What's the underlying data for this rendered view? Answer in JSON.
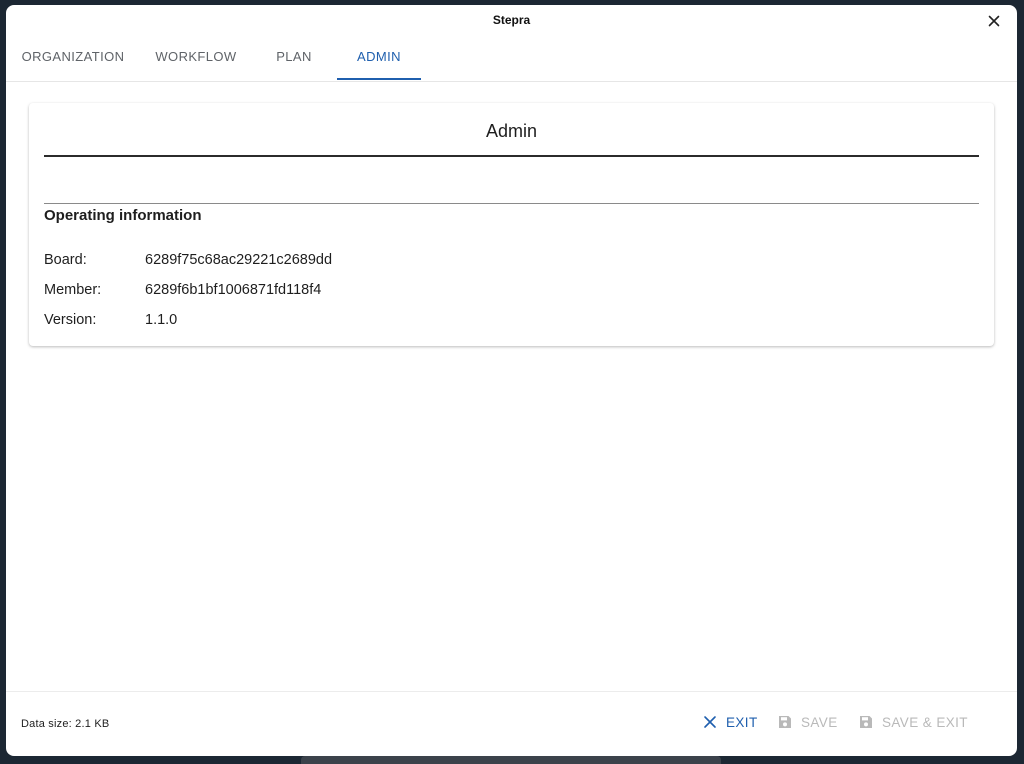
{
  "window": {
    "title": "Stepra"
  },
  "tabs": [
    {
      "label": "ORGANIZATION",
      "active": false
    },
    {
      "label": "WORKFLOW",
      "active": false
    },
    {
      "label": "PLAN",
      "active": false
    },
    {
      "label": "ADMIN",
      "active": true
    }
  ],
  "card": {
    "title": "Admin",
    "section_heading": "Operating information",
    "rows": [
      {
        "label": "Board:",
        "value": "6289f75c68ac29221c2689dd"
      },
      {
        "label": "Member:",
        "value": "6289f6b1bf1006871fd118f4"
      },
      {
        "label": "Version:",
        "value": "1.1.0"
      }
    ]
  },
  "footer": {
    "data_size": "Data size: 2.1 KB",
    "exit_label": "EXIT",
    "save_label": "SAVE",
    "save_exit_label": "SAVE & EXIT"
  },
  "colors": {
    "accent": "#1f5fae",
    "disabled": "#b9b9b9",
    "backdrop": "#1c2733"
  },
  "icons": {
    "close": "close-icon",
    "exit": "close-icon",
    "save": "floppy-disk-icon"
  }
}
